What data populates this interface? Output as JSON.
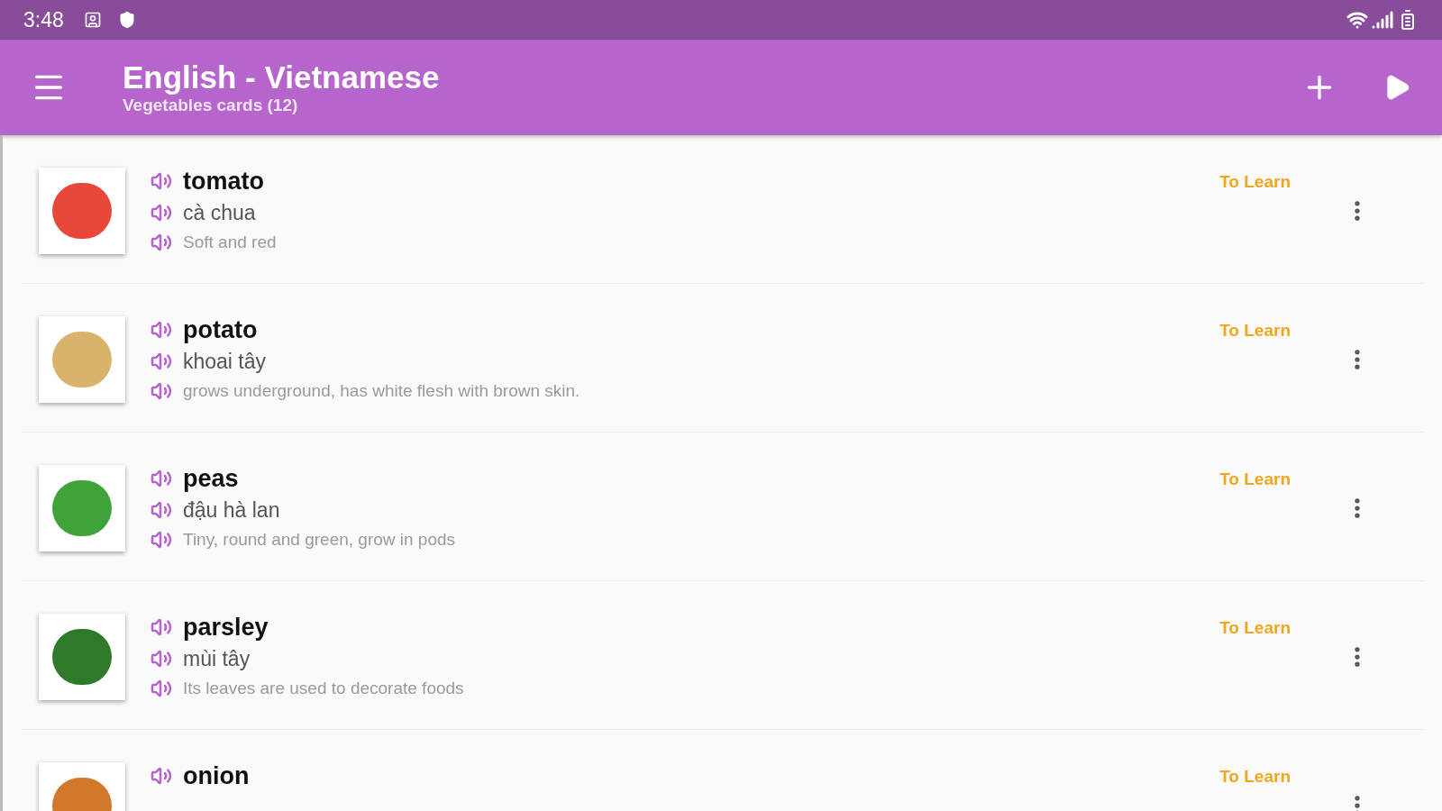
{
  "status_bar": {
    "time": "3:48"
  },
  "app_bar": {
    "title": "English - Vietnamese",
    "subtitle": "Vegetables cards (12)"
  },
  "cards": [
    {
      "word": "tomato",
      "translation": "cà chua",
      "description": "Soft and red",
      "status": "To Learn"
    },
    {
      "word": "potato",
      "translation": "khoai tây",
      "description": "grows underground, has white flesh with brown skin.",
      "status": "To Learn"
    },
    {
      "word": "peas",
      "translation": "đậu hà lan",
      "description": "Tiny, round and green, grow in pods",
      "status": "To Learn"
    },
    {
      "word": "parsley",
      "translation": "mùi tây",
      "description": "Its leaves are used to decorate foods",
      "status": "To Learn"
    },
    {
      "word": "onion",
      "status": "To Learn"
    }
  ]
}
